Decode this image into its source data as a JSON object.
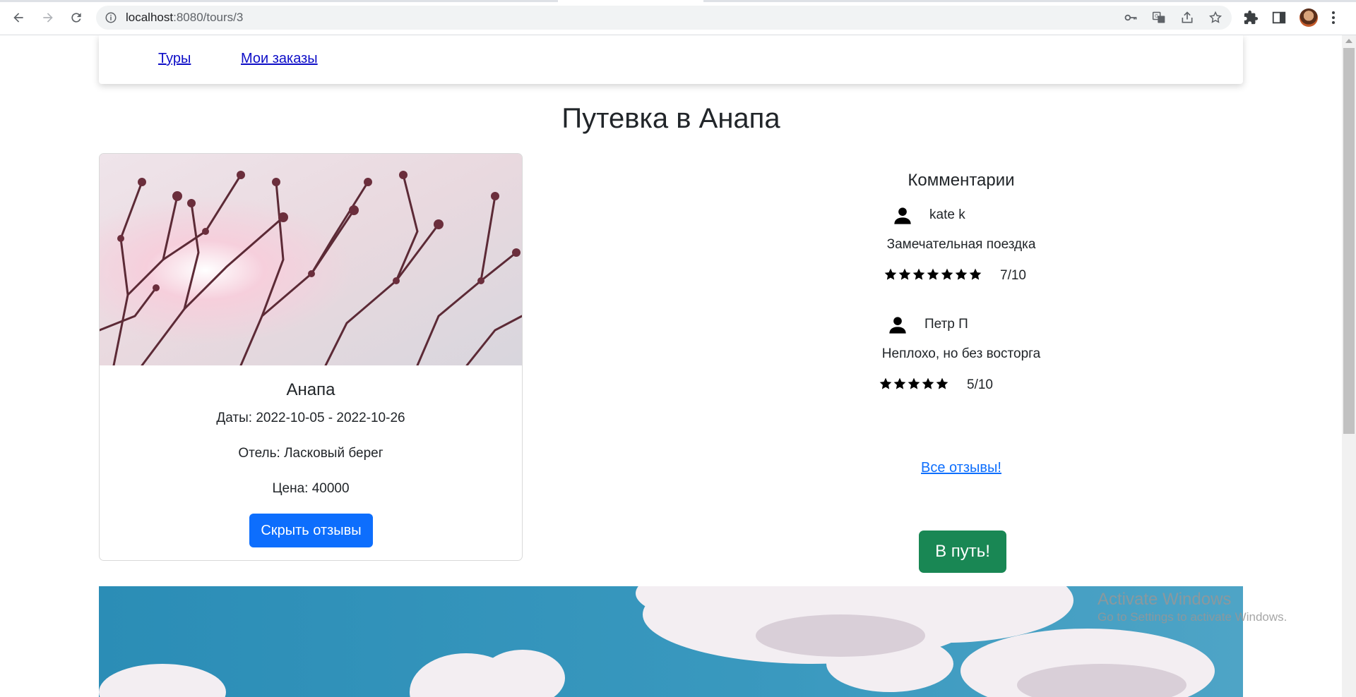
{
  "browser": {
    "url_host": "localhost",
    "url_path": ":8080/tours/3",
    "icons": [
      "back-icon",
      "forward-icon",
      "reload-icon",
      "info-icon",
      "key-icon",
      "translate-icon",
      "share-icon",
      "star-icon",
      "extensions-icon",
      "side-panel-icon",
      "avatar",
      "more-icon"
    ]
  },
  "nav": {
    "tours": "Туры",
    "orders": "Мои заказы"
  },
  "page": {
    "title": "Путевка в Анапа"
  },
  "tour": {
    "name": "Анапа",
    "dates": "Даты: 2022-10-05 - 2022-10-26",
    "hotel": "Отель: Ласковый берег",
    "price": "Цена: 40000",
    "toggle_reviews_button": "Скрыть отзывы"
  },
  "comments": {
    "title": "Комментарии",
    "items": [
      {
        "author": "kate k",
        "text": "Замечательная поездка",
        "stars": 7,
        "score": "7/10"
      },
      {
        "author": "Петр П",
        "text": "Неплохо, но без восторга",
        "stars": 5,
        "score": "5/10"
      }
    ],
    "all_reviews_link": "Все отзывы!",
    "go_button": "В путь!"
  },
  "watermark": {
    "line1": "Activate Windows",
    "line2": "Go to Settings to activate Windows."
  },
  "colors": {
    "link": "#0d0dc7",
    "primary": "#0d6efd",
    "success": "#198754"
  }
}
